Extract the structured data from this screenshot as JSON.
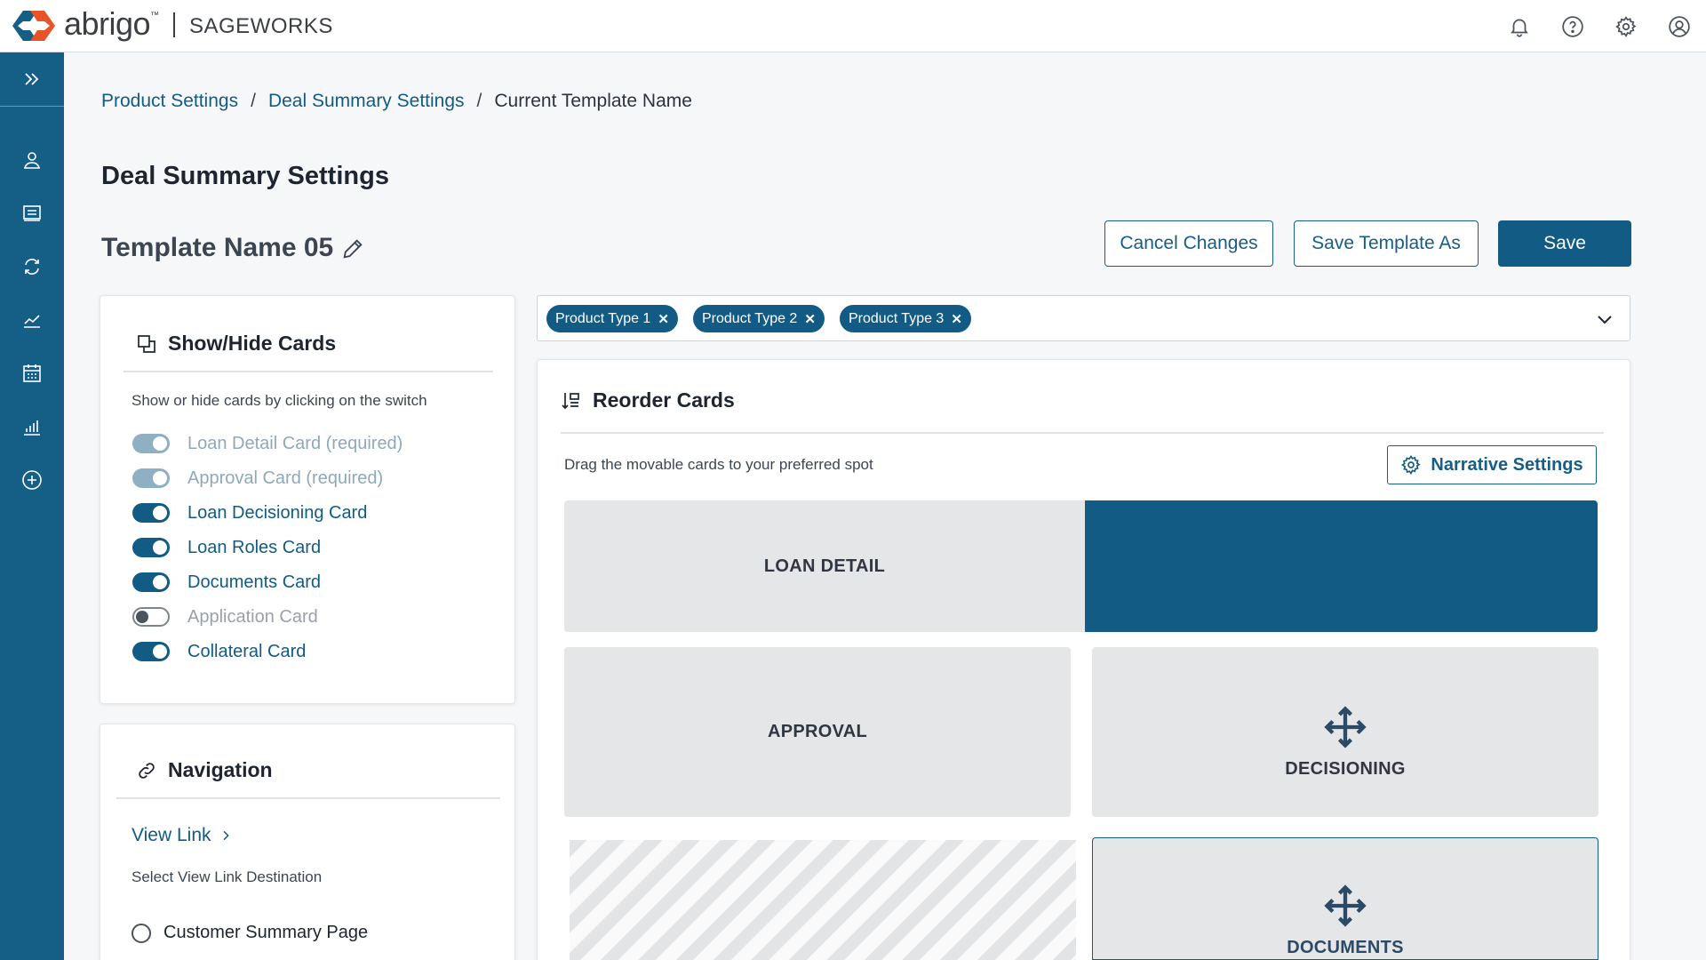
{
  "brand": {
    "name": "abrigo",
    "tm": "™",
    "product": "SAGEWORKS"
  },
  "topbar": {
    "icons": [
      "bell-icon",
      "help-icon",
      "gear-icon",
      "user-circle-icon"
    ]
  },
  "sidebar": {
    "icons": [
      "expand-chevrons-icon",
      "person-icon",
      "monitor-icon",
      "refresh-icon",
      "line-chart-icon",
      "calendar-icon",
      "bar-chart-icon",
      "plus-circle-icon"
    ]
  },
  "breadcrumb": {
    "items": [
      "Product Settings",
      "Deal Summary Settings"
    ],
    "separator": "/",
    "current": "Current Template Name"
  },
  "page": {
    "title": "Deal Summary Settings",
    "template_name": "Template Name 05"
  },
  "actions": {
    "cancel": "Cancel Changes",
    "save_as": "Save Template As",
    "save": "Save"
  },
  "showhide": {
    "title": "Show/Hide Cards",
    "hint": "Show or hide cards by clicking on the switch",
    "toggles": [
      {
        "label": "Loan Detail Card (required)",
        "state": "disabled-on"
      },
      {
        "label": "Approval Card (required)",
        "state": "disabled-on"
      },
      {
        "label": "Loan Decisioning Card",
        "state": "on"
      },
      {
        "label": "Loan Roles Card",
        "state": "on"
      },
      {
        "label": "Documents Card",
        "state": "on"
      },
      {
        "label": "Application Card",
        "state": "off"
      },
      {
        "label": "Collateral Card",
        "state": "on"
      }
    ]
  },
  "navigation": {
    "title": "Navigation",
    "view_link": "View Link",
    "view_link_hint": "Select View Link Destination",
    "options": [
      "Customer Summary Page"
    ]
  },
  "product_types": [
    "Product Type 1",
    "Product Type 2",
    "Product Type 3"
  ],
  "reorder": {
    "title": "Reorder Cards",
    "hint": "Drag the movable cards to your preferred spot",
    "narrative_button": "Narrative Settings",
    "cards": {
      "loan_detail": "LOAN DETAIL",
      "approval": "APPROVAL",
      "decisioning": "DECISIONING",
      "documents": "DOCUMENTS"
    }
  },
  "colors": {
    "primary": "#125b85",
    "sidebar": "#155e86",
    "background": "#f6f7f9"
  }
}
